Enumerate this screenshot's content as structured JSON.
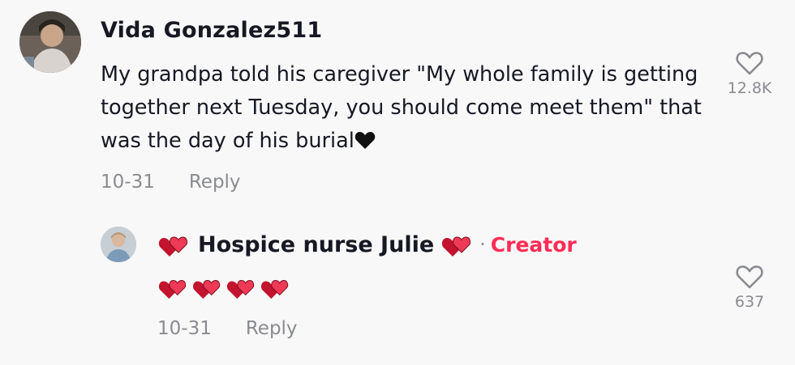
{
  "comment": {
    "username": "Vida Gonzalez511",
    "text": "My grandpa told his caregiver \"My whole family is getting together next Tuesday, you should come meet them\" that was the day of his burial",
    "date": "10-31",
    "reply_label": "Reply",
    "likes": "12.8K"
  },
  "reply": {
    "username": "Hospice nurse Julie",
    "separator": "·",
    "badge": "Creator",
    "date": "10-31",
    "reply_label": "Reply",
    "likes": "637",
    "emoji_count": 4
  },
  "icons": {
    "like": "heart-outline-icon",
    "name_decoration": "two-hearts-emoji",
    "text_end": "black-heart-emoji"
  },
  "colors": {
    "background": "#f8f8f8",
    "text": "#161823",
    "muted": "#8a8b91",
    "creator": "#fe2c55",
    "emoji_heart": "#e0243c"
  }
}
